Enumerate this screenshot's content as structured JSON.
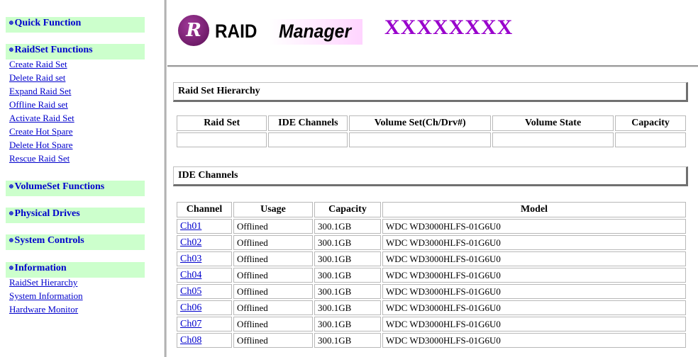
{
  "sidebar": {
    "sections": [
      {
        "label": "Quick Function",
        "links": []
      },
      {
        "label": "RaidSet Functions",
        "links": [
          "Create Raid Set",
          "Delete Raid set",
          "Expand Raid Set",
          "Offline Raid set",
          "Activate Raid Set",
          "Create Hot Spare",
          "Delete Hot Spare",
          "Rescue Raid Set"
        ]
      },
      {
        "label": "VolumeSet Functions",
        "links": []
      },
      {
        "label": "Physical Drives",
        "links": []
      },
      {
        "label": "System Controls",
        "links": []
      },
      {
        "label": "Information",
        "links": [
          "RaidSet Hierarchy",
          "System Information",
          "Hardware Monitor"
        ]
      }
    ]
  },
  "header": {
    "logo_letter": "R",
    "logo_word1": "RAID",
    "logo_word2": "Manager",
    "device_name": "XXXXXXXX"
  },
  "raid_hierarchy": {
    "title": "Raid Set Hierarchy",
    "columns": [
      "Raid Set",
      "IDE Channels",
      "Volume Set(Ch/Drv#)",
      "Volume State",
      "Capacity"
    ],
    "rows": [
      [
        "",
        "",
        "",
        "",
        ""
      ]
    ]
  },
  "ide_channels": {
    "title": "IDE Channels",
    "columns": [
      "Channel",
      "Usage",
      "Capacity",
      "Model"
    ],
    "rows": [
      [
        "Ch01",
        "Offlined",
        "300.1GB",
        "WDC WD3000HLFS-01G6U0"
      ],
      [
        "Ch02",
        "Offlined",
        "300.1GB",
        "WDC WD3000HLFS-01G6U0"
      ],
      [
        "Ch03",
        "Offlined",
        "300.1GB",
        "WDC WD3000HLFS-01G6U0"
      ],
      [
        "Ch04",
        "Offlined",
        "300.1GB",
        "WDC WD3000HLFS-01G6U0"
      ],
      [
        "Ch05",
        "Offlined",
        "300.1GB",
        "WDC WD3000HLFS-01G6U0"
      ],
      [
        "Ch06",
        "Offlined",
        "300.1GB",
        "WDC WD3000HLFS-01G6U0"
      ],
      [
        "Ch07",
        "Offlined",
        "300.1GB",
        "WDC WD3000HLFS-01G6U0"
      ],
      [
        "Ch08",
        "Offlined",
        "300.1GB",
        "WDC WD3000HLFS-01G6U0"
      ]
    ]
  },
  "colors": {
    "sidebar_head_bg": "#ccffcc",
    "link": "#0000cc",
    "device_name": "#9900cc"
  }
}
